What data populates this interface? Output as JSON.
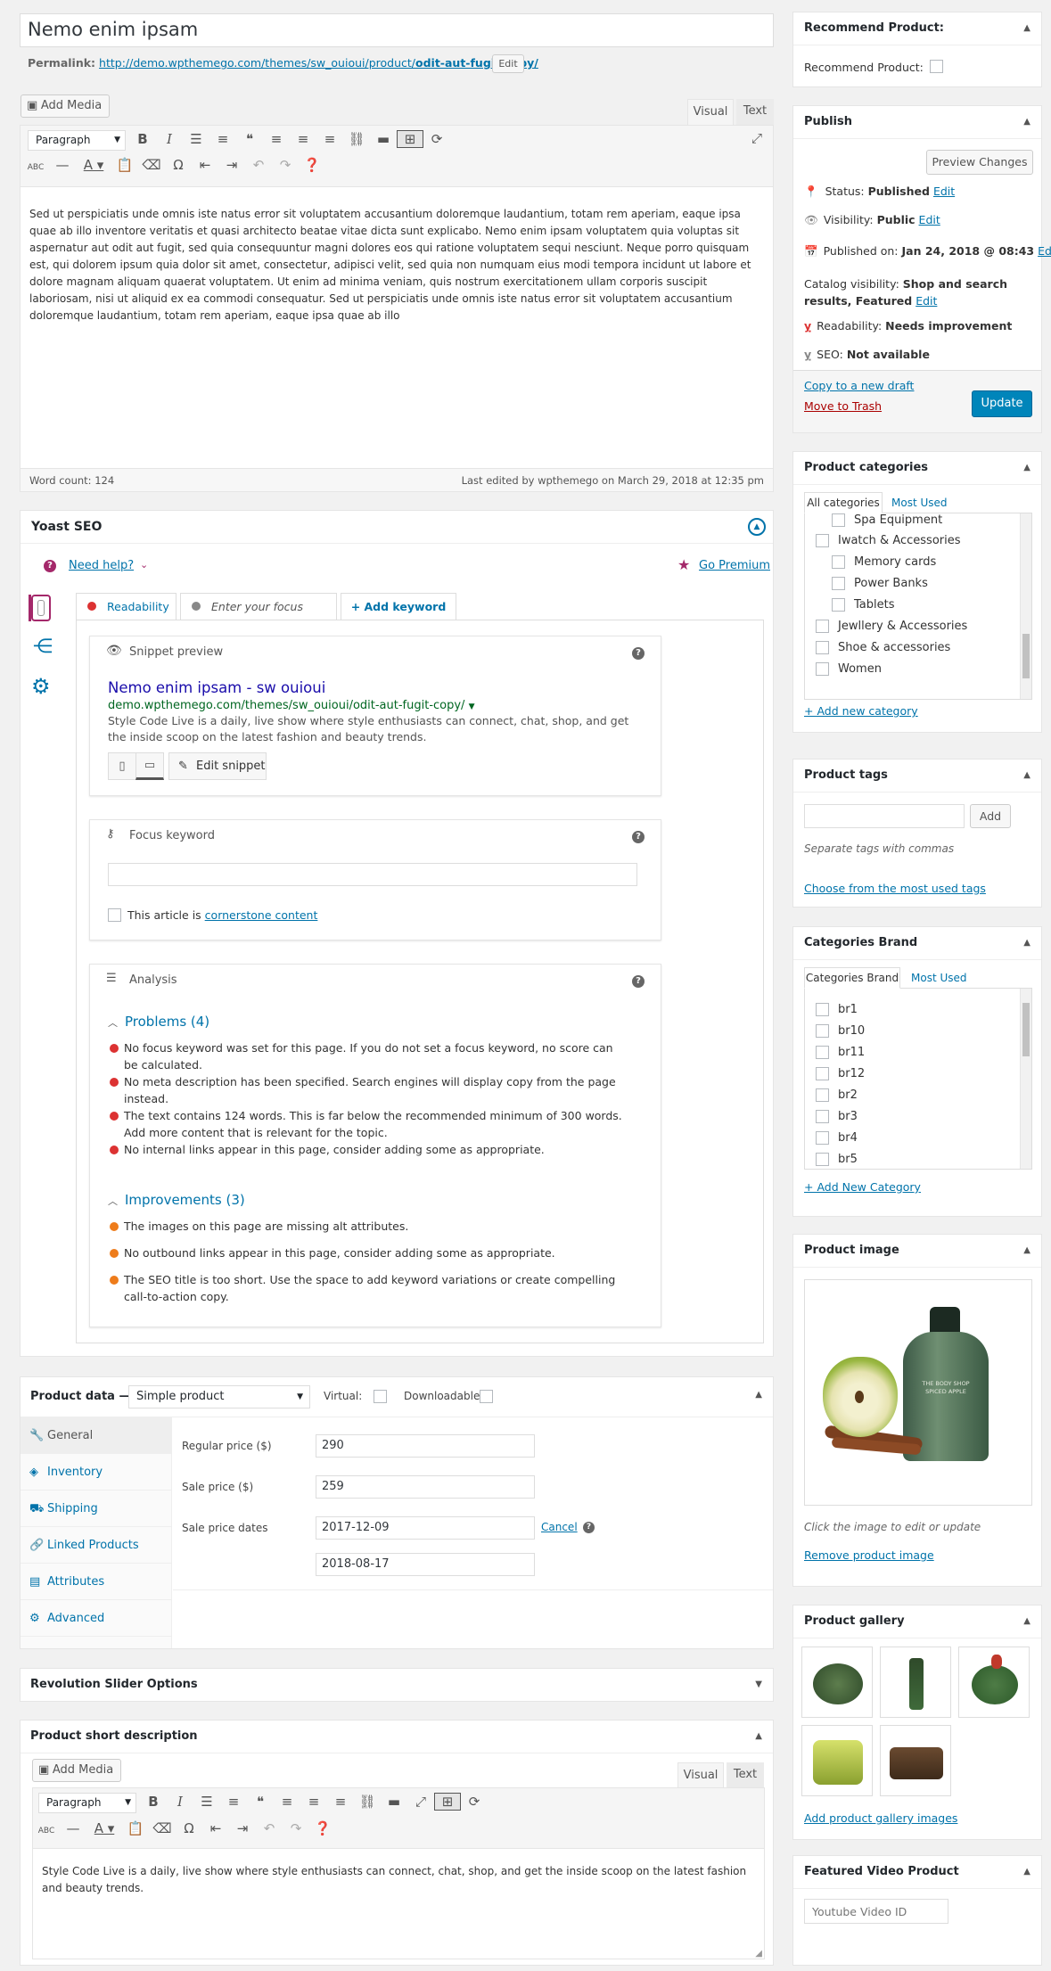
{
  "title": "Nemo enim ipsam",
  "permalink": {
    "label": "Permalink:",
    "url": "http://demo.wpthemego.com/themes/sw_ouioui/product/",
    "slug": "odit-aut-fugit-copy/",
    "edit": "Edit"
  },
  "add_media": "Add Media",
  "editor": {
    "tab_visual": "Visual",
    "tab_text": "Text",
    "format": "Paragraph",
    "content": "Sed ut perspiciatis unde omnis iste natus error sit voluptatem accusantium doloremque laudantium, totam rem aperiam, eaque ipsa quae ab illo inventore veritatis et quasi architecto beatae vitae dicta sunt explicabo. Nemo enim ipsam voluptatem quia voluptas sit aspernatur aut odit aut fugit, sed quia consequuntur magni dolores eos qui ratione voluptatem sequi nesciunt. Neque porro quisquam est, qui dolorem ipsum quia dolor sit amet, consectetur, adipisci velit, sed quia non numquam eius modi tempora incidunt ut labore et dolore magnam aliquam quaerat voluptatem. Ut enim ad minima veniam, quis nostrum exercitationem ullam corporis suscipit laboriosam, nisi ut aliquid ex ea commodi consequatur. Sed ut perspiciatis unde omnis iste natus error sit voluptatem accusantium doloremque laudantium, totam rem aperiam, eaque ipsa quae ab illo",
    "word_count": "Word count: 124",
    "last_edited": "Last edited by wpthemego on March 29, 2018 at 12:35 pm"
  },
  "yoast": {
    "title": "Yoast SEO",
    "need_help": "Need help?",
    "go_premium": "Go Premium",
    "tab_readability": "Readability",
    "tab_focus": "Enter your focus key...",
    "tab_add": "+ Add keyword",
    "snippet_label": "Snippet preview",
    "snippet_title": "Nemo enim ipsam - sw ouioui",
    "snippet_url": "demo.wpthemego.com/themes/sw_ouioui/odit-aut-fugit-copy/",
    "snippet_desc": "Style Code Live is a daily, live show where style enthusiasts can connect, chat, shop, and get the inside scoop on the latest fashion and beauty trends.",
    "edit_snippet": "Edit snippet",
    "focus_label": "Focus keyword",
    "cornerstone_pre": "This article is ",
    "cornerstone_link": "cornerstone content",
    "analysis_label": "Analysis",
    "problems_title": "Problems (4)",
    "problems": [
      "No focus keyword was set for this page. If you do not set a focus keyword, no score can be calculated.",
      "No meta description has been specified. Search engines will display copy from the page instead.",
      "The text contains 124 words. This is far below the recommended minimum of 300 words. Add more content that is relevant for the topic.",
      "No internal links appear in this page, consider adding some as appropriate."
    ],
    "improvements_title": "Improvements (3)",
    "improvements": [
      "The images on this page are missing alt attributes.",
      "No outbound links appear in this page, consider adding some as appropriate.",
      "The SEO title is too short. Use the space to add keyword variations or create compelling call-to-action copy."
    ]
  },
  "product_data": {
    "label": "Product data —",
    "type": "Simple product",
    "virtual": "Virtual:",
    "downloadable": "Downloadable:",
    "tabs": [
      "General",
      "Inventory",
      "Shipping",
      "Linked Products",
      "Attributes",
      "Advanced"
    ],
    "regular_label": "Regular price ($)",
    "regular": "290",
    "sale_label": "Sale price ($)",
    "sale": "259",
    "dates_label": "Sale price dates",
    "date_from": "2017-12-09",
    "date_to": "2018-08-17",
    "cancel": "Cancel"
  },
  "rev_slider": "Revolution Slider Options",
  "short_desc": {
    "title": "Product short description",
    "content": "Style Code Live is a daily, live show where style enthusiasts can connect, chat, shop, and get the inside scoop on the latest fashion and beauty trends."
  },
  "recommend": {
    "title": "Recommend Product:",
    "label": "Recommend Product:"
  },
  "publish": {
    "title": "Publish",
    "preview": "Preview Changes",
    "status_label": "Status:",
    "status": "Published",
    "visibility_label": "Visibility:",
    "visibility": "Public",
    "published_label": "Published on:",
    "published": "Jan 24, 2018 @ 08:43",
    "catalog_label": "Catalog visibility:",
    "catalog": "Shop and search results, Featured",
    "readability_label": "Readability:",
    "readability": "Needs improvement",
    "seo_label": "SEO:",
    "seo": "Not available",
    "edit": "Edit",
    "copy_draft": "Copy to a new draft",
    "trash": "Move to Trash",
    "update": "Update"
  },
  "categories": {
    "title": "Product categories",
    "tab_all": "All categories",
    "tab_most": "Most Used",
    "items": [
      "Spa Equipment",
      "Iwatch & Accessories",
      "Memory cards",
      "Power Banks",
      "Tablets",
      "Jewllery & Accessories",
      "Shoe & accessories",
      "Women"
    ],
    "add": "+ Add new category"
  },
  "tags": {
    "title": "Product tags",
    "add": "Add",
    "hint": "Separate tags with commas",
    "choose": "Choose from the most used tags"
  },
  "brand": {
    "title": "Categories Brand",
    "tab_all": "Categories Brand",
    "tab_most": "Most Used",
    "items": [
      "br1",
      "br10",
      "br11",
      "br12",
      "br2",
      "br3",
      "br4",
      "br5"
    ],
    "add": "+ Add New Category"
  },
  "product_image": {
    "title": "Product image",
    "bottle_label": "THE BODY SHOP SPICED APPLE",
    "hint": "Click the image to edit or update",
    "remove": "Remove product image"
  },
  "gallery": {
    "title": "Product gallery",
    "add": "Add product gallery images"
  },
  "video": {
    "title": "Featured Video Product",
    "placeholder": "Youtube Video ID"
  }
}
